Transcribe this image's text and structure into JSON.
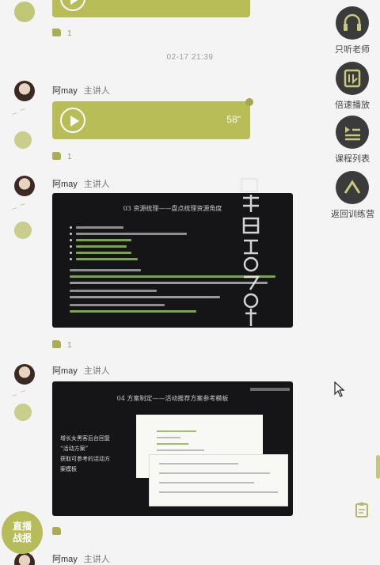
{
  "messages": [
    {
      "duration": "",
      "likes": "1"
    },
    {
      "timestamp": "02-17 21:39"
    },
    {
      "speaker": "阿may",
      "role": "主讲人",
      "duration": "58\"",
      "likes": "1"
    },
    {
      "speaker": "阿may",
      "role": "主讲人",
      "likes": "1",
      "slide": {
        "title": "03 资源梳理——盘点梳理资源角度"
      }
    },
    {
      "speaker": "阿may",
      "role": "主讲人",
      "likes": "",
      "slide": {
        "title": "04 方案制定——活动推荐方案参考模板",
        "body": [
          "增长女黑客后台回复",
          "“活动方案”",
          "获取可参考的活动方",
          "案模板"
        ]
      }
    },
    {
      "speaker": "阿may",
      "role": "主讲人"
    }
  ],
  "sidebar": {
    "items": [
      {
        "label": "只听老师",
        "icon": "headphones-icon"
      },
      {
        "label": "倍速播放",
        "icon": "speed-icon"
      },
      {
        "label": "课程列表",
        "icon": "list-icon"
      },
      {
        "label": "返回训练营",
        "icon": "up-arrow-icon"
      }
    ]
  },
  "live_badge": {
    "line1": "直播",
    "line2": "战报"
  },
  "colors": {
    "accent": "#b8bd58",
    "sidebar": "#3b3b3b",
    "background": "#f4f4f4"
  }
}
